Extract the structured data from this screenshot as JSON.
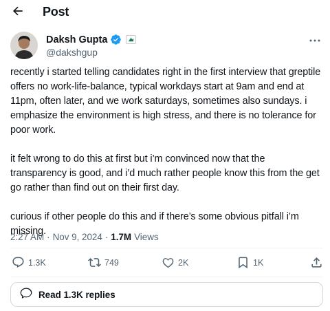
{
  "header": {
    "title": "Post"
  },
  "author": {
    "name": "Daksh Gupta",
    "handle": "@dakshgup",
    "verified_color": "#1d9bf0"
  },
  "tweet": {
    "paragraphs": [
      "recently i started telling candidates right in the first interview that greptile offers no work-life-balance, typical workdays start at 9am and end at 11pm, often later, and we work saturdays, sometimes also sundays. i emphasize the environment is high stress, and there is no tolerance for poor work.",
      "it felt wrong to do this at first but i’m convinced now that the transparency is good, and i’d much rather people know this from the get go rather than find out on their first day.",
      "curious if other people do this and if there’s some obvious pitfall i’m missing."
    ]
  },
  "meta": {
    "time": "2:27 AM",
    "separator": "·",
    "date": "Nov 9, 2024",
    "views_count": "1.7M",
    "views_label": "Views"
  },
  "actions": {
    "replies": "1.3K",
    "reposts": "749",
    "likes": "2K",
    "bookmarks": "1K"
  },
  "replies_button": {
    "label": "Read 1.3K replies"
  },
  "icons": {
    "back": "arrow-left-icon",
    "more": "more-horizontal-icon",
    "verified": "verified-badge-icon",
    "affiliate": "affiliate-badge-icon",
    "reply": "reply-icon",
    "repost": "repost-icon",
    "like": "heart-icon",
    "bookmark": "bookmark-icon",
    "share": "share-icon",
    "replies_bubble": "speech-bubble-icon"
  }
}
